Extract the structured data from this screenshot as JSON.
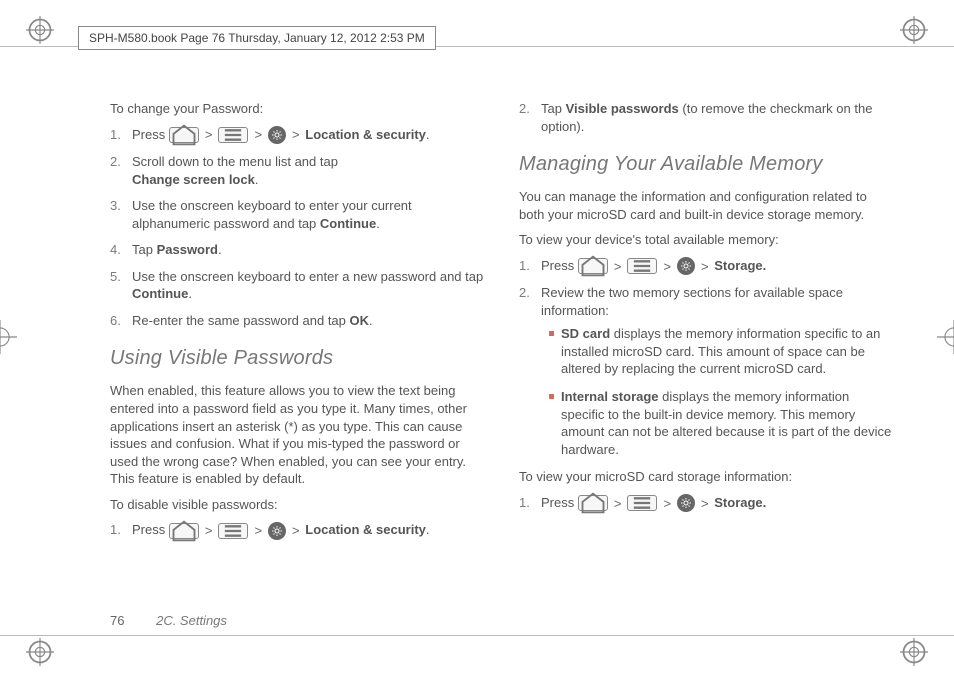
{
  "header_label": "SPH-M580.book  Page 76  Thursday, January 12, 2012  2:53 PM",
  "col1": {
    "intro1": "To change your Password:",
    "steps_a": {
      "s1_a": "Press ",
      "s1_b": "Location & security",
      "s2_a": "Scroll down to the menu list and tap ",
      "s2_b": "Change screen lock",
      "s3": "Use the onscreen keyboard to enter your current alphanumeric password and tap ",
      "s3_b": "Continue",
      "s4_a": "Tap ",
      "s4_b": "Password",
      "s5": "Use the onscreen keyboard to enter a new password and tap ",
      "s5_b": "Continue",
      "s6": "Re-enter the same password and tap ",
      "s6_b": "OK"
    },
    "h_visible": "Using Visible Passwords",
    "visible_body": "When enabled, this feature allows you to view the text being entered into a password field as you type it. Many times, other applications insert an asterisk (*) as you type. This can cause issues and confusion. What if you mis-typed the password or used the wrong case? When enabled, you can see your entry. This feature is enabled by default.",
    "intro2": "To disable visible passwords:",
    "steps_b": {
      "s1_a": "Press ",
      "s1_b": "Location & security"
    }
  },
  "col2": {
    "cont_step2_a": "Tap ",
    "cont_step2_b": "Visible passwords",
    "cont_step2_c": " (to remove the checkmark on the option).",
    "h_memory": "Managing Your Available Memory",
    "memory_body": "You can manage the information and configuration related to both your microSD card and built-in device storage memory.",
    "intro3": "To view your device's total available memory:",
    "steps_c": {
      "s1_a": "Press ",
      "s1_b": "Storage.",
      "s2": "Review the two memory sections for available space information:"
    },
    "bullets": {
      "b1_label": "SD card",
      "b1_text": " displays the memory information specific to an installed microSD card. This amount of space can be altered by replacing the current microSD card.",
      "b2_label": "Internal storage",
      "b2_text": " displays the memory information specific to the built-in device memory. This memory amount can not be altered because it is part of the device hardware."
    },
    "intro4": "To view your microSD card storage information:",
    "steps_d": {
      "s1_a": "Press ",
      "s1_b": "Storage."
    }
  },
  "footer": {
    "page": "76",
    "section": "2C. Settings"
  }
}
